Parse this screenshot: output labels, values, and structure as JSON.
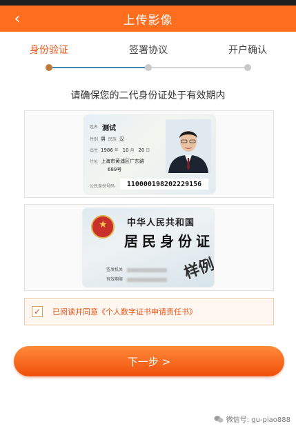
{
  "header": {
    "title": "上传影像",
    "back_icon": "chevron-left-icon"
  },
  "steps": {
    "items": [
      {
        "label": "身份验证",
        "active": true
      },
      {
        "label": "签署协议",
        "active": false
      },
      {
        "label": "开户确认",
        "active": false
      }
    ]
  },
  "notice": "请确保您的二代身份证处于有效期内",
  "id_front": {
    "name": "测试",
    "gender": "男",
    "ethnicity": "汉",
    "birth_year": "1986",
    "birth_month": "10",
    "birth_day": "20",
    "address_line1": "上海市黄浦区广东路",
    "address_line2": "689号",
    "id_number": "110000198202229156"
  },
  "id_back": {
    "title": "中华人民共和国",
    "subtitle": "居民身份证",
    "sample_stamp": "样例"
  },
  "agreement": {
    "checked": true,
    "text": "已阅读并同意《个人数字证书申请责任书》"
  },
  "next_button": {
    "label": "下一步 >"
  },
  "watermark": {
    "text": "微信号: gu-piao888"
  },
  "colors": {
    "primary": "#ff6d1f",
    "accent": "#e8541a",
    "progress": "#3d8ab3"
  }
}
